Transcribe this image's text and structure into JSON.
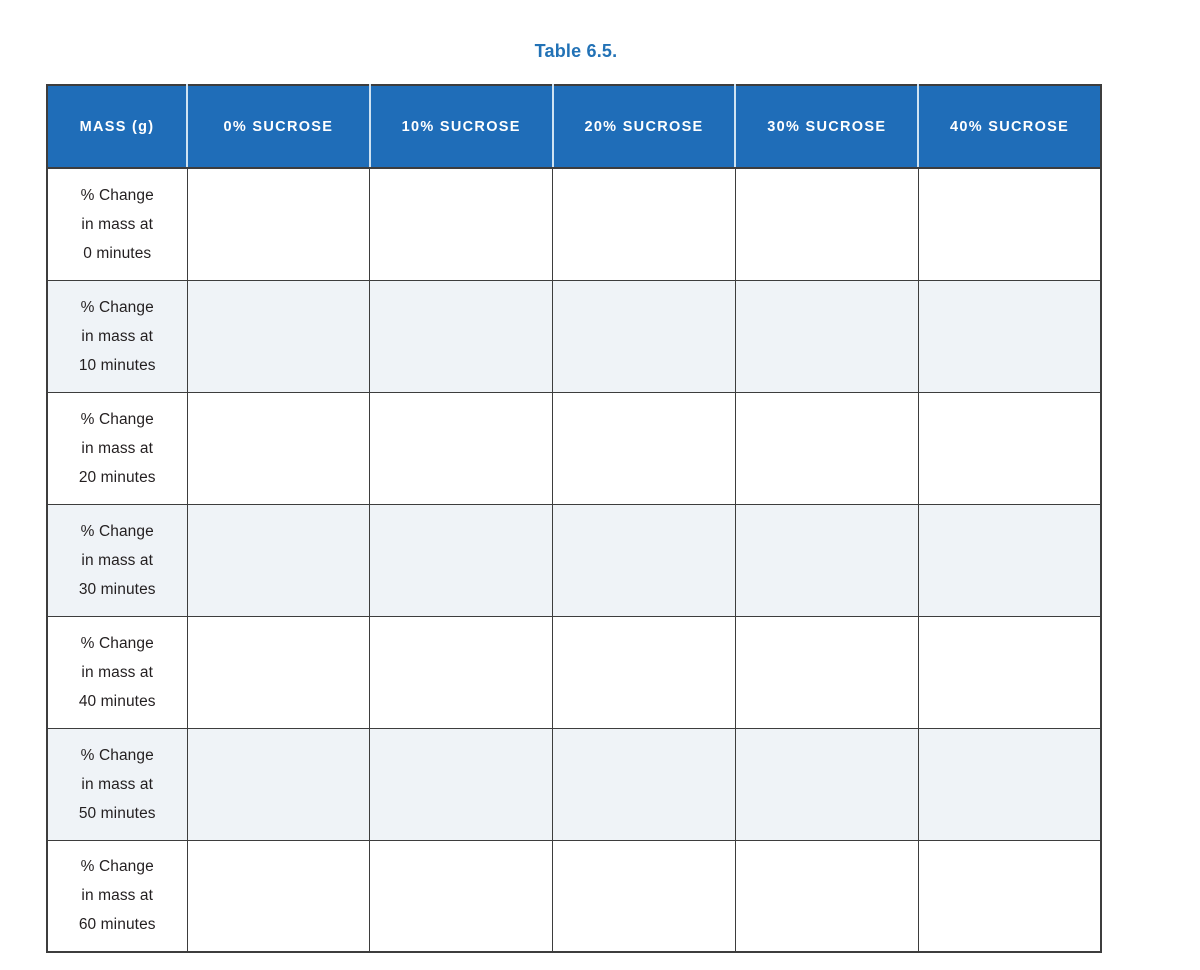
{
  "title": "Table 6.5.",
  "accent_color": "#2272b6",
  "header_bg_color": "#1f6db8",
  "alt_row_color": "#eff3f7",
  "grid_color": "#3d3d3d",
  "table": {
    "columns": [
      "MASS (g)",
      "0% SUCROSE",
      "10% SUCROSE",
      "20% SUCROSE",
      "30% SUCROSE",
      "40% SUCROSE"
    ],
    "rows": [
      {
        "label_lines": [
          "% Change",
          "in mass at",
          "0 minutes"
        ],
        "cells": [
          "",
          "",
          "",
          "",
          ""
        ]
      },
      {
        "label_lines": [
          "% Change",
          "in mass at",
          "10 minutes"
        ],
        "cells": [
          "",
          "",
          "",
          "",
          ""
        ]
      },
      {
        "label_lines": [
          "% Change",
          "in mass at",
          "20 minutes"
        ],
        "cells": [
          "",
          "",
          "",
          "",
          ""
        ]
      },
      {
        "label_lines": [
          "% Change",
          "in mass at",
          "30 minutes"
        ],
        "cells": [
          "",
          "",
          "",
          "",
          ""
        ]
      },
      {
        "label_lines": [
          "% Change",
          "in mass at",
          "40 minutes"
        ],
        "cells": [
          "",
          "",
          "",
          "",
          ""
        ]
      },
      {
        "label_lines": [
          "% Change",
          "in mass at",
          "50 minutes"
        ],
        "cells": [
          "",
          "",
          "",
          "",
          ""
        ]
      },
      {
        "label_lines": [
          "% Change",
          "in mass at",
          "60 minutes"
        ],
        "cells": [
          "",
          "",
          "",
          "",
          ""
        ]
      }
    ]
  }
}
